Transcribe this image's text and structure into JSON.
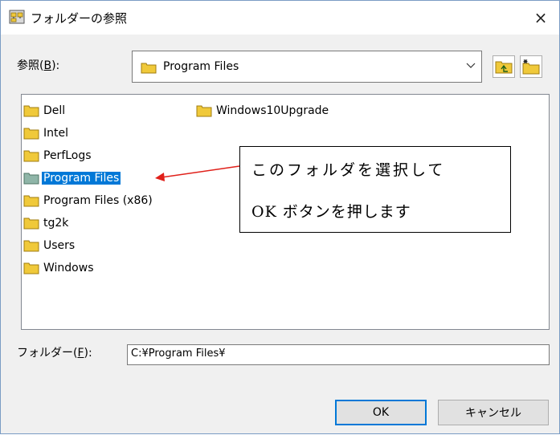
{
  "window": {
    "title": "フォルダーの参照",
    "close_glyph": "×"
  },
  "browse": {
    "label_prefix": "参照(",
    "label_key": "B",
    "label_suffix": "):",
    "selected_value": "Program Files"
  },
  "tree": {
    "items": [
      {
        "label": "Dell",
        "selected": false
      },
      {
        "label": "Windows10Upgrade",
        "selected": false
      },
      {
        "label": "Intel",
        "selected": false
      },
      {
        "label": "PerfLogs",
        "selected": false
      },
      {
        "label": "Program Files",
        "selected": true
      },
      {
        "label": "Program Files (x86)",
        "selected": false
      },
      {
        "label": "tg2k",
        "selected": false
      },
      {
        "label": "Users",
        "selected": false
      },
      {
        "label": "Windows",
        "selected": false
      }
    ]
  },
  "callout": {
    "line1": "このフォルダを選択して",
    "line2": "OK ボタンを押します"
  },
  "folder_field": {
    "label_prefix": "フォルダー(",
    "label_key": "F",
    "label_suffix": "):",
    "value": "C:¥Program Files¥"
  },
  "buttons": {
    "ok": "OK",
    "cancel": "キャンセル"
  },
  "colors": {
    "selection": "#0078d7",
    "arrow": "#e0201a",
    "folder": "#f0c93a"
  }
}
